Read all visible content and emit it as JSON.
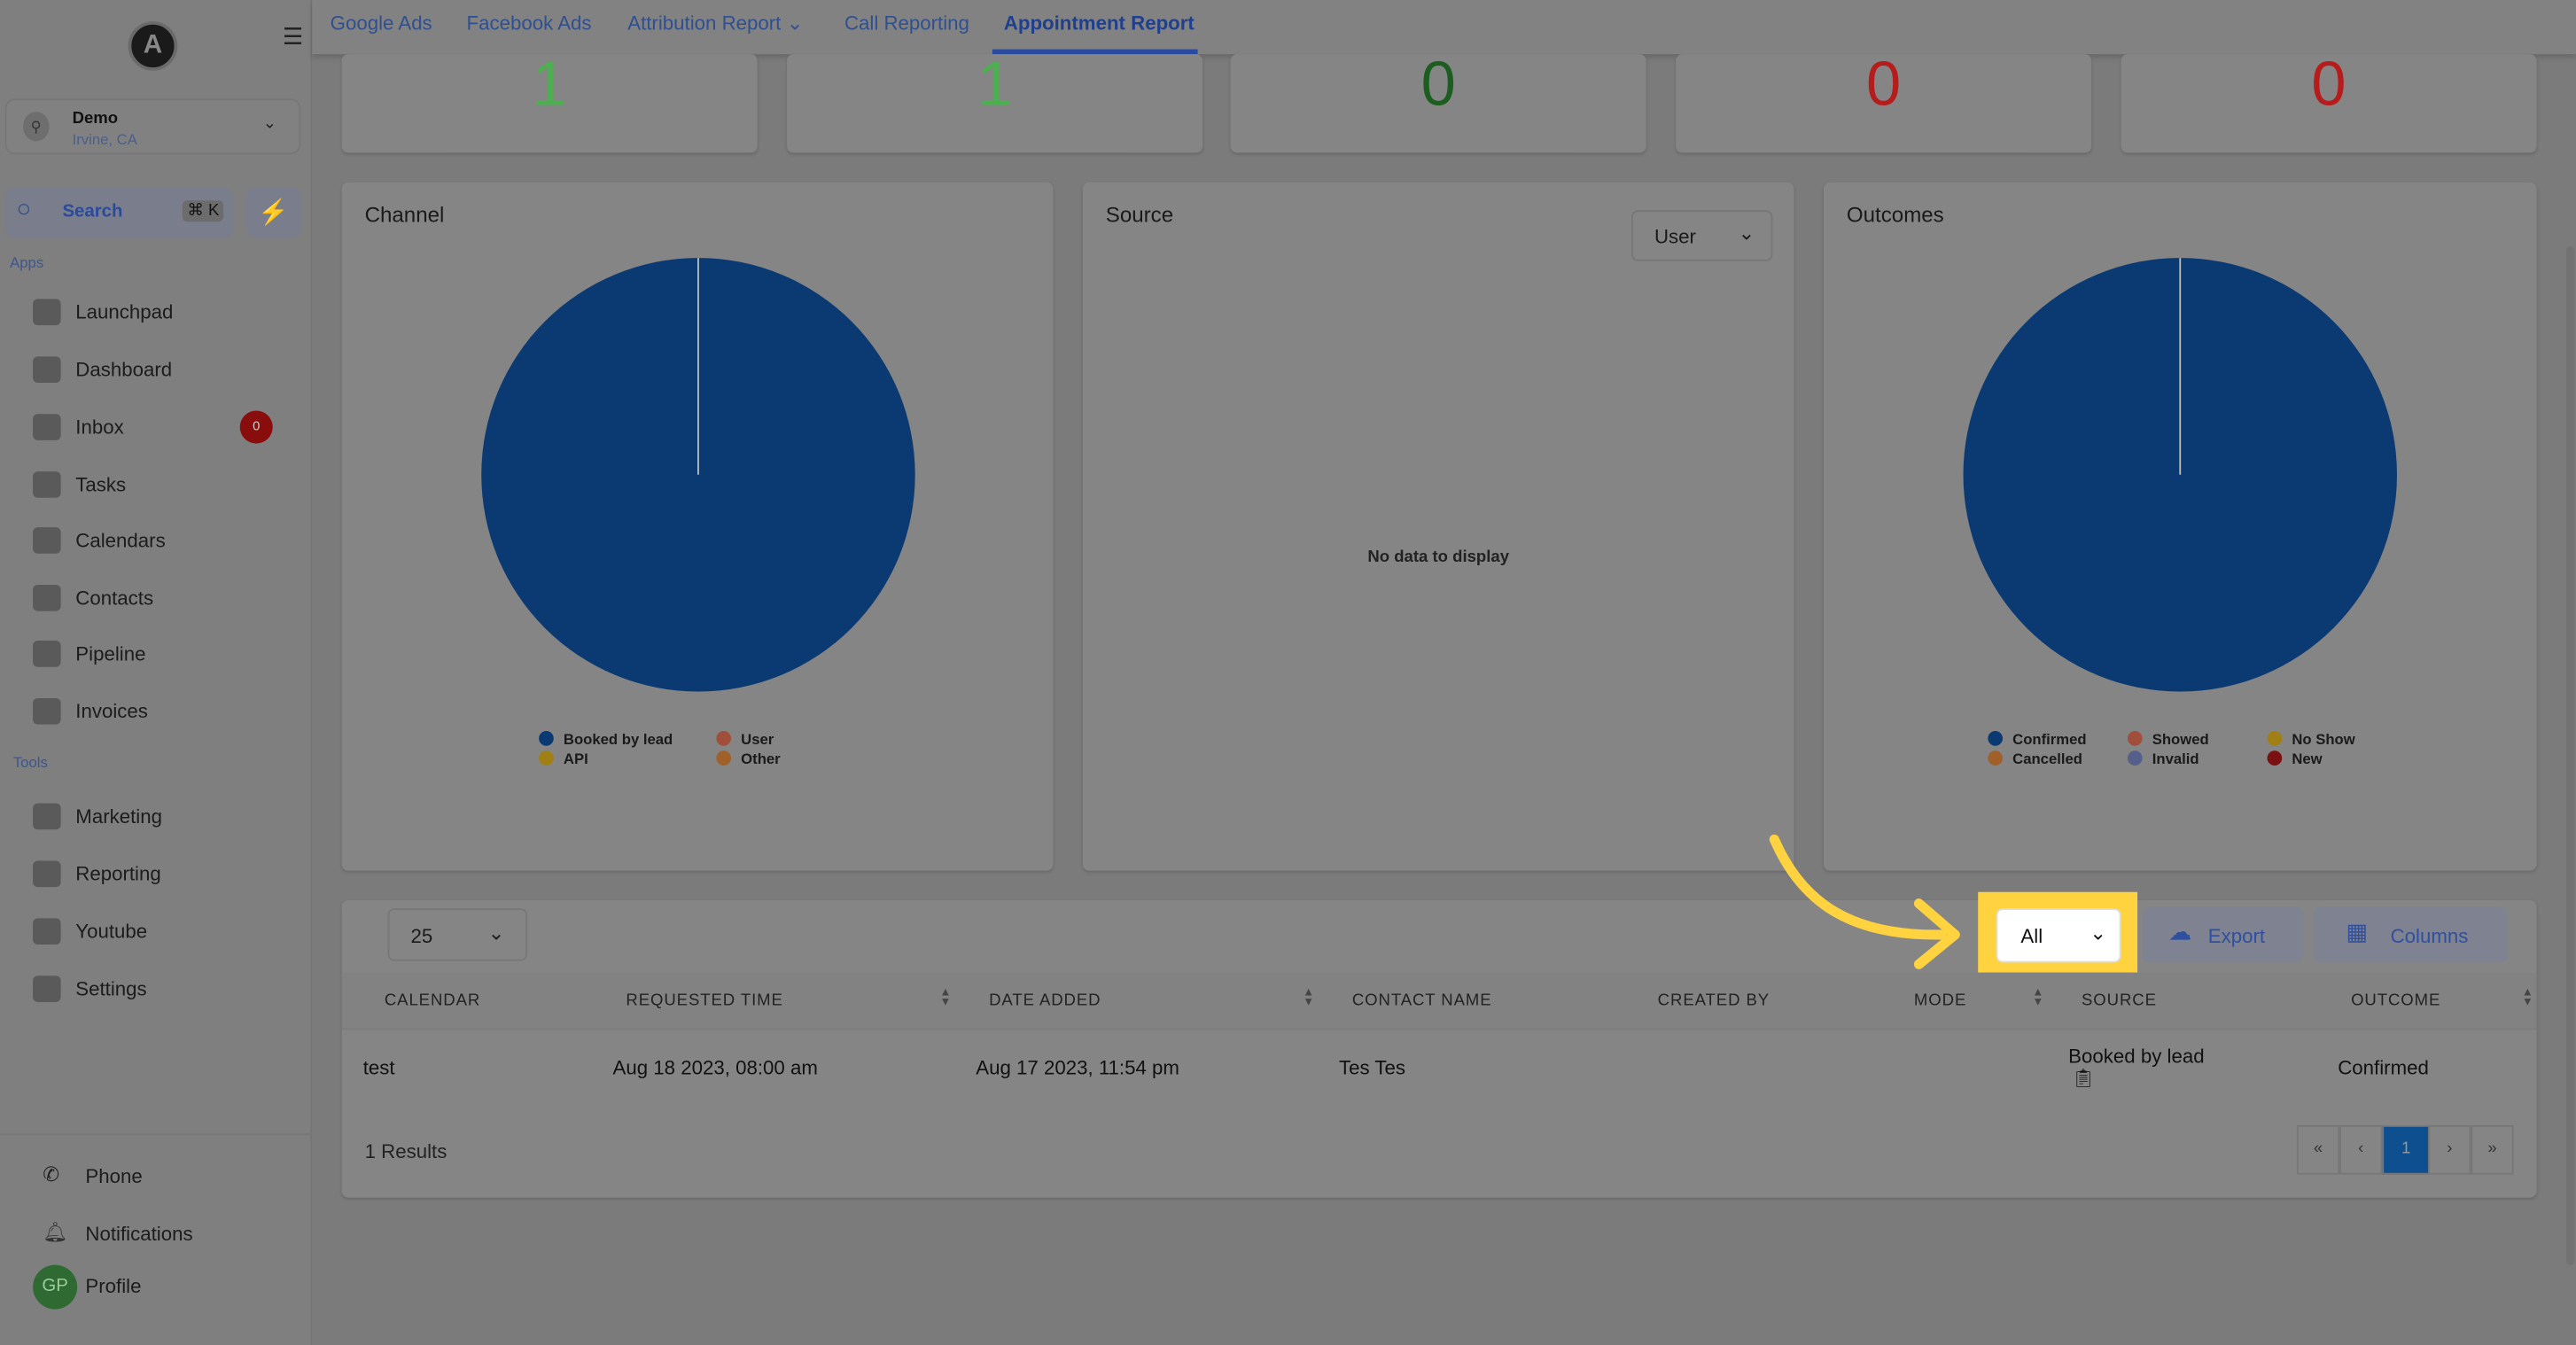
{
  "sidebar": {
    "logo_letter": "A",
    "account": {
      "name": "Demo",
      "location": "Irvine, CA"
    },
    "search": {
      "label": "Search",
      "shortcut": "⌘ K"
    },
    "sections": {
      "apps": "Apps",
      "tools": "Tools"
    },
    "apps": [
      {
        "label": "Launchpad"
      },
      {
        "label": "Dashboard"
      },
      {
        "label": "Inbox",
        "badge": "0"
      },
      {
        "label": "Tasks"
      },
      {
        "label": "Calendars"
      },
      {
        "label": "Contacts"
      },
      {
        "label": "Pipeline"
      },
      {
        "label": "Invoices"
      }
    ],
    "tools": [
      {
        "label": "Marketing"
      },
      {
        "label": "Reporting"
      },
      {
        "label": "Youtube"
      },
      {
        "label": "Settings"
      }
    ],
    "bottom": [
      {
        "label": "Phone"
      },
      {
        "label": "Notifications"
      },
      {
        "label": "Profile",
        "avatar": "GP"
      }
    ]
  },
  "tabs": [
    {
      "label": "Google Ads"
    },
    {
      "label": "Facebook Ads"
    },
    {
      "label": "Attribution Report"
    },
    {
      "label": "Call Reporting"
    },
    {
      "label": "Appointment Report",
      "active": true
    }
  ],
  "stats": [
    {
      "value": "1",
      "color": "#4caf50"
    },
    {
      "value": "1",
      "color": "#4caf50"
    },
    {
      "value": "0",
      "color": "#1b5e20"
    },
    {
      "value": "0",
      "color": "#b71c1c"
    },
    {
      "value": "0",
      "color": "#b71c1c"
    }
  ],
  "charts": {
    "channel": {
      "title": "Channel",
      "legend": [
        "Booked by lead",
        "User",
        "API",
        "Other"
      ],
      "legend_colors": [
        "#0b3a73",
        "#a0503a",
        "#a08014",
        "#a0602a"
      ]
    },
    "source": {
      "title": "Source",
      "dropdown": "User",
      "empty": "No data to display"
    },
    "outcomes": {
      "title": "Outcomes",
      "legend": [
        "Confirmed",
        "Showed",
        "No Show",
        "Cancelled",
        "Invalid",
        "New"
      ],
      "legend_colors": [
        "#0b3a73",
        "#a0503a",
        "#a08014",
        "#a0602a",
        "#55608a",
        "#7a1010"
      ]
    }
  },
  "chart_data": [
    {
      "type": "pie",
      "title": "Channel",
      "categories": [
        "Booked by lead",
        "User",
        "API",
        "Other"
      ],
      "values": [
        1,
        0,
        0,
        0
      ]
    },
    {
      "type": "pie",
      "title": "Outcomes",
      "categories": [
        "Confirmed",
        "Showed",
        "No Show",
        "Cancelled",
        "Invalid",
        "New"
      ],
      "values": [
        1,
        0,
        0,
        0,
        0,
        0
      ]
    }
  ],
  "table": {
    "page_size": "25",
    "filter": "All",
    "export": "Export",
    "columns_btn": "Columns",
    "headers": [
      "CALENDAR",
      "REQUESTED TIME",
      "DATE ADDED",
      "CONTACT NAME",
      "CREATED BY",
      "MODE",
      "SOURCE",
      "OUTCOME"
    ],
    "rows": [
      {
        "calendar": "test",
        "requested": "Aug 18 2023, 08:00 am",
        "added": "Aug 17 2023, 11:54 pm",
        "contact": "Tes Tes",
        "created_by": "",
        "mode": "",
        "source": "Booked by lead",
        "outcome": "Confirmed"
      }
    ],
    "results": "1 Results",
    "pagination": {
      "first": "«",
      "prev": "‹",
      "current": "1",
      "next": "›",
      "last": "»"
    }
  },
  "highlight_color": "#ffd23f"
}
